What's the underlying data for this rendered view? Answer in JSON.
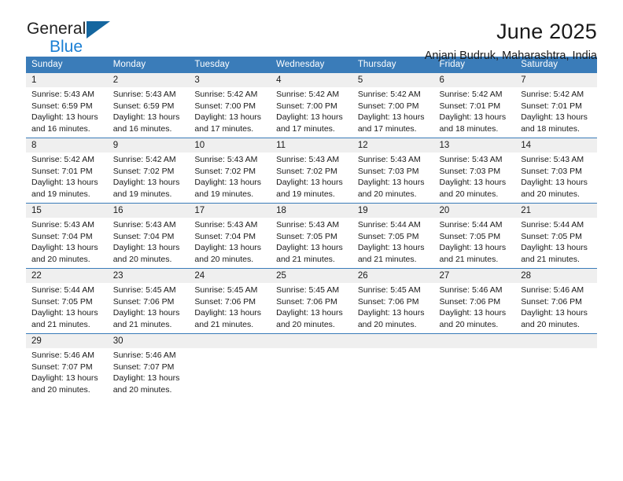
{
  "brand": {
    "name_top": "General",
    "name_bottom": "Blue"
  },
  "header": {
    "title": "June 2025",
    "subtitle": "Anjani Budruk, Maharashtra, India"
  },
  "colors": {
    "header_blue": "#3a7cb9",
    "logo_blue": "#1a7fd4",
    "logo_triangle": "#14669f",
    "daynum_band": "#efefef",
    "text": "#1a1a1a"
  },
  "calendar": {
    "weekdays": [
      "Sunday",
      "Monday",
      "Tuesday",
      "Wednesday",
      "Thursday",
      "Friday",
      "Saturday"
    ],
    "weeks": [
      [
        {
          "day": "1",
          "sunrise": "Sunrise: 5:43 AM",
          "sunset": "Sunset: 6:59 PM",
          "daylight1": "Daylight: 13 hours",
          "daylight2": "and 16 minutes."
        },
        {
          "day": "2",
          "sunrise": "Sunrise: 5:43 AM",
          "sunset": "Sunset: 6:59 PM",
          "daylight1": "Daylight: 13 hours",
          "daylight2": "and 16 minutes."
        },
        {
          "day": "3",
          "sunrise": "Sunrise: 5:42 AM",
          "sunset": "Sunset: 7:00 PM",
          "daylight1": "Daylight: 13 hours",
          "daylight2": "and 17 minutes."
        },
        {
          "day": "4",
          "sunrise": "Sunrise: 5:42 AM",
          "sunset": "Sunset: 7:00 PM",
          "daylight1": "Daylight: 13 hours",
          "daylight2": "and 17 minutes."
        },
        {
          "day": "5",
          "sunrise": "Sunrise: 5:42 AM",
          "sunset": "Sunset: 7:00 PM",
          "daylight1": "Daylight: 13 hours",
          "daylight2": "and 17 minutes."
        },
        {
          "day": "6",
          "sunrise": "Sunrise: 5:42 AM",
          "sunset": "Sunset: 7:01 PM",
          "daylight1": "Daylight: 13 hours",
          "daylight2": "and 18 minutes."
        },
        {
          "day": "7",
          "sunrise": "Sunrise: 5:42 AM",
          "sunset": "Sunset: 7:01 PM",
          "daylight1": "Daylight: 13 hours",
          "daylight2": "and 18 minutes."
        }
      ],
      [
        {
          "day": "8",
          "sunrise": "Sunrise: 5:42 AM",
          "sunset": "Sunset: 7:01 PM",
          "daylight1": "Daylight: 13 hours",
          "daylight2": "and 19 minutes."
        },
        {
          "day": "9",
          "sunrise": "Sunrise: 5:42 AM",
          "sunset": "Sunset: 7:02 PM",
          "daylight1": "Daylight: 13 hours",
          "daylight2": "and 19 minutes."
        },
        {
          "day": "10",
          "sunrise": "Sunrise: 5:43 AM",
          "sunset": "Sunset: 7:02 PM",
          "daylight1": "Daylight: 13 hours",
          "daylight2": "and 19 minutes."
        },
        {
          "day": "11",
          "sunrise": "Sunrise: 5:43 AM",
          "sunset": "Sunset: 7:02 PM",
          "daylight1": "Daylight: 13 hours",
          "daylight2": "and 19 minutes."
        },
        {
          "day": "12",
          "sunrise": "Sunrise: 5:43 AM",
          "sunset": "Sunset: 7:03 PM",
          "daylight1": "Daylight: 13 hours",
          "daylight2": "and 20 minutes."
        },
        {
          "day": "13",
          "sunrise": "Sunrise: 5:43 AM",
          "sunset": "Sunset: 7:03 PM",
          "daylight1": "Daylight: 13 hours",
          "daylight2": "and 20 minutes."
        },
        {
          "day": "14",
          "sunrise": "Sunrise: 5:43 AM",
          "sunset": "Sunset: 7:03 PM",
          "daylight1": "Daylight: 13 hours",
          "daylight2": "and 20 minutes."
        }
      ],
      [
        {
          "day": "15",
          "sunrise": "Sunrise: 5:43 AM",
          "sunset": "Sunset: 7:04 PM",
          "daylight1": "Daylight: 13 hours",
          "daylight2": "and 20 minutes."
        },
        {
          "day": "16",
          "sunrise": "Sunrise: 5:43 AM",
          "sunset": "Sunset: 7:04 PM",
          "daylight1": "Daylight: 13 hours",
          "daylight2": "and 20 minutes."
        },
        {
          "day": "17",
          "sunrise": "Sunrise: 5:43 AM",
          "sunset": "Sunset: 7:04 PM",
          "daylight1": "Daylight: 13 hours",
          "daylight2": "and 20 minutes."
        },
        {
          "day": "18",
          "sunrise": "Sunrise: 5:43 AM",
          "sunset": "Sunset: 7:05 PM",
          "daylight1": "Daylight: 13 hours",
          "daylight2": "and 21 minutes."
        },
        {
          "day": "19",
          "sunrise": "Sunrise: 5:44 AM",
          "sunset": "Sunset: 7:05 PM",
          "daylight1": "Daylight: 13 hours",
          "daylight2": "and 21 minutes."
        },
        {
          "day": "20",
          "sunrise": "Sunrise: 5:44 AM",
          "sunset": "Sunset: 7:05 PM",
          "daylight1": "Daylight: 13 hours",
          "daylight2": "and 21 minutes."
        },
        {
          "day": "21",
          "sunrise": "Sunrise: 5:44 AM",
          "sunset": "Sunset: 7:05 PM",
          "daylight1": "Daylight: 13 hours",
          "daylight2": "and 21 minutes."
        }
      ],
      [
        {
          "day": "22",
          "sunrise": "Sunrise: 5:44 AM",
          "sunset": "Sunset: 7:05 PM",
          "daylight1": "Daylight: 13 hours",
          "daylight2": "and 21 minutes."
        },
        {
          "day": "23",
          "sunrise": "Sunrise: 5:45 AM",
          "sunset": "Sunset: 7:06 PM",
          "daylight1": "Daylight: 13 hours",
          "daylight2": "and 21 minutes."
        },
        {
          "day": "24",
          "sunrise": "Sunrise: 5:45 AM",
          "sunset": "Sunset: 7:06 PM",
          "daylight1": "Daylight: 13 hours",
          "daylight2": "and 21 minutes."
        },
        {
          "day": "25",
          "sunrise": "Sunrise: 5:45 AM",
          "sunset": "Sunset: 7:06 PM",
          "daylight1": "Daylight: 13 hours",
          "daylight2": "and 20 minutes."
        },
        {
          "day": "26",
          "sunrise": "Sunrise: 5:45 AM",
          "sunset": "Sunset: 7:06 PM",
          "daylight1": "Daylight: 13 hours",
          "daylight2": "and 20 minutes."
        },
        {
          "day": "27",
          "sunrise": "Sunrise: 5:46 AM",
          "sunset": "Sunset: 7:06 PM",
          "daylight1": "Daylight: 13 hours",
          "daylight2": "and 20 minutes."
        },
        {
          "day": "28",
          "sunrise": "Sunrise: 5:46 AM",
          "sunset": "Sunset: 7:06 PM",
          "daylight1": "Daylight: 13 hours",
          "daylight2": "and 20 minutes."
        }
      ],
      [
        {
          "day": "29",
          "sunrise": "Sunrise: 5:46 AM",
          "sunset": "Sunset: 7:07 PM",
          "daylight1": "Daylight: 13 hours",
          "daylight2": "and 20 minutes."
        },
        {
          "day": "30",
          "sunrise": "Sunrise: 5:46 AM",
          "sunset": "Sunset: 7:07 PM",
          "daylight1": "Daylight: 13 hours",
          "daylight2": "and 20 minutes."
        },
        {
          "day": "",
          "sunrise": "",
          "sunset": "",
          "daylight1": "",
          "daylight2": ""
        },
        {
          "day": "",
          "sunrise": "",
          "sunset": "",
          "daylight1": "",
          "daylight2": ""
        },
        {
          "day": "",
          "sunrise": "",
          "sunset": "",
          "daylight1": "",
          "daylight2": ""
        },
        {
          "day": "",
          "sunrise": "",
          "sunset": "",
          "daylight1": "",
          "daylight2": ""
        },
        {
          "day": "",
          "sunrise": "",
          "sunset": "",
          "daylight1": "",
          "daylight2": ""
        }
      ]
    ]
  }
}
